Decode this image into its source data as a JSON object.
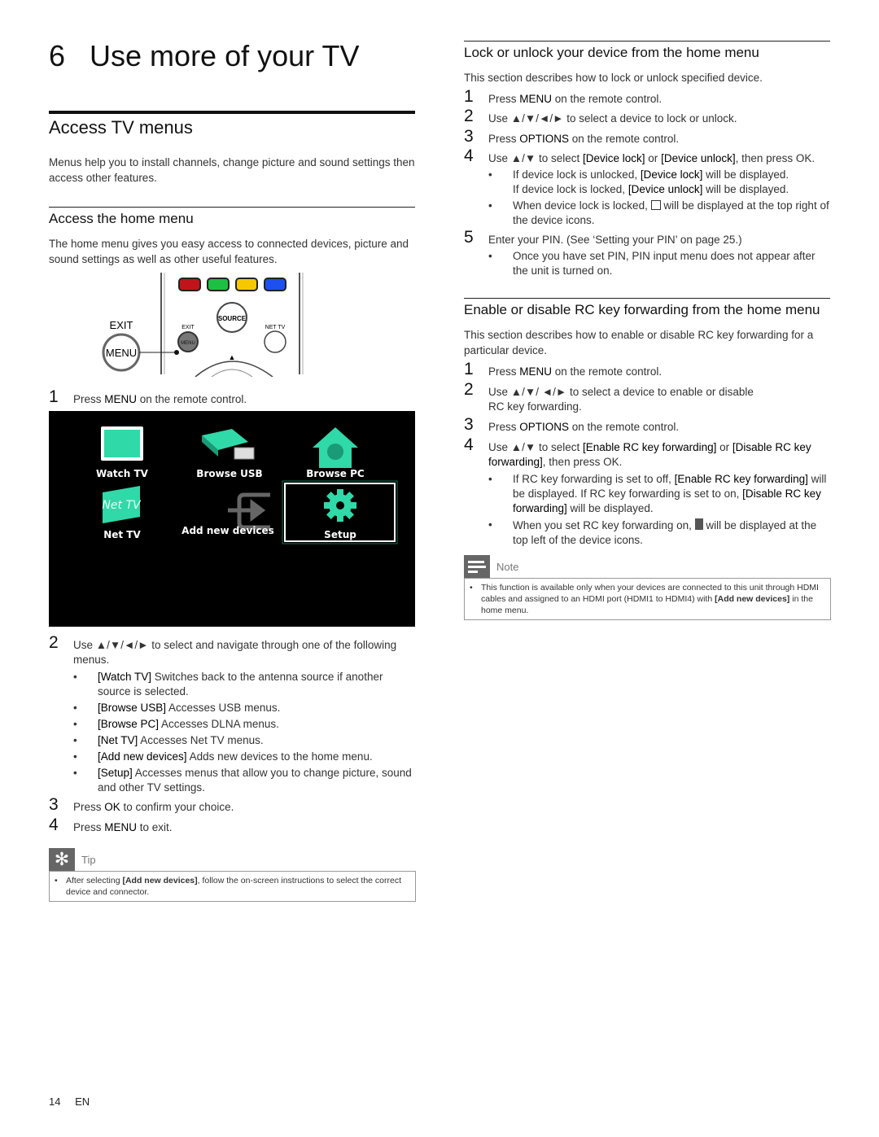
{
  "chapter": {
    "number": "6",
    "title": "Use more of your TV"
  },
  "left": {
    "section_title": "Access TV menus",
    "intro": "Menus help you to install channels, change picture and sound settings then access other features.",
    "subsection_title": "Access the home menu",
    "sub_intro": "The home menu gives you easy access to connected devices, picture and sound settings as well as other useful features.",
    "remote": {
      "exit_label": "EXIT",
      "menu_label": "MENU",
      "source_label": "SOURCE",
      "small_exit_label": "EXIT",
      "small_menu_label": "MENU",
      "nettv_label": "NET TV",
      "up_arrow": "▲",
      "button_colors": [
        "#c0141a",
        "#1dc042",
        "#f5c800",
        "#1e4ff0"
      ]
    },
    "step1": {
      "n": "1",
      "pre": "Press ",
      "key": "MENU",
      "post": " on the remote control."
    },
    "home_menu": {
      "items": [
        {
          "label": "Watch TV",
          "icon": "tv-icon"
        },
        {
          "label": "Browse USB",
          "icon": "usb-icon"
        },
        {
          "label": "Browse PC",
          "icon": "home-network-icon"
        },
        {
          "label": "Net TV",
          "icon": "nettv-icon",
          "icon_text": "Net TV"
        },
        {
          "label": "Add new devices",
          "icon": "add-device-icon"
        },
        {
          "label": "Setup",
          "icon": "gear-icon",
          "selected": true
        }
      ],
      "accent": "#2fd9a8"
    },
    "step2": {
      "n": "2",
      "text": "Use ▲/▼/◄/► to select and navigate through one of the following menus."
    },
    "step2_bullets": [
      {
        "key": "[Watch TV]",
        "text": " Switches back to the antenna source if another source is selected."
      },
      {
        "key": "[Browse USB]",
        "text": " Accesses USB menus."
      },
      {
        "key": "[Browse PC]",
        "text": " Accesses DLNA menus."
      },
      {
        "key": "[Net TV]",
        "text": " Accesses Net TV menus."
      },
      {
        "key": "[Add new devices]",
        "text": " Adds new devices to the home menu."
      },
      {
        "key": "[Setup]",
        "text": " Accesses menus that allow you to change picture, sound and other TV settings."
      }
    ],
    "step3": {
      "n": "3",
      "pre": "Press ",
      "key": "OK",
      "post": " to confirm your choice."
    },
    "step4": {
      "n": "4",
      "pre": "Press ",
      "key": "MENU",
      "post": " to exit."
    },
    "tip": {
      "label": "Tip",
      "pre": "After selecting ",
      "key": "[Add new devices]",
      "post": ", follow the on-screen instructions to select the correct device and connector."
    }
  },
  "right": {
    "lock": {
      "title": "Lock or unlock your device from the home menu",
      "intro": "This section describes how to lock or unlock specified device.",
      "s1": {
        "n": "1",
        "pre": "Press ",
        "key": "MENU",
        "post": " on the remote control."
      },
      "s2": {
        "n": "2",
        "text": "Use ▲/▼/◄/► to select a device to lock or unlock."
      },
      "s3": {
        "n": "3",
        "pre": "Press ",
        "key": "OPTIONS",
        "post": " on the remote control."
      },
      "s4": {
        "n": "4",
        "pre": "Use ▲/▼ to select ",
        "k1": "[Device lock]",
        "mid": " or ",
        "k2": "[Device unlock]",
        "post": ", then press OK."
      },
      "b1": {
        "l1pre": "If device lock is unlocked, ",
        "l1key": "[Device lock]",
        "l1post": " will be displayed.",
        "l2pre": "If device lock is locked, ",
        "l2key": "[Device unlock]",
        "l2post": " will be displayed."
      },
      "b2": {
        "pre": "When device lock is locked, ",
        "post": " will be displayed at the top right of the device icons."
      },
      "s5": {
        "n": "5",
        "text": "Enter your PIN. (See ‘Setting your PIN’ on page 25.)"
      },
      "b3": {
        "text": "Once you have set PIN, PIN input menu does not appear after the unit is turned on."
      }
    },
    "rc": {
      "title": "Enable or disable RC key forwarding from the home menu",
      "intro": "This section describes how to enable or disable RC key forwarding for a particular device.",
      "s1": {
        "n": "1",
        "pre": "Press ",
        "key": "MENU",
        "post": " on the remote control."
      },
      "s2": {
        "n": "2",
        "line1": "Use ▲/▼/ ◄/► to select a device to enable or disable",
        "line2": "RC key forwarding."
      },
      "s3": {
        "n": "3",
        "pre": "Press ",
        "key": "OPTIONS",
        "post": " on the remote control."
      },
      "s4": {
        "n": "4",
        "pre": "Use ▲/▼ to select ",
        "k1": "[Enable RC key forwarding]",
        "mid": " or ",
        "k2": "[Disable RC key forwarding]",
        "post": ", then press OK."
      },
      "b1": {
        "pre": "If RC key forwarding is set to off, ",
        "k1": "[Enable RC key forwarding]",
        "mid": " will be displayed. If RC key forwarding is set to on, ",
        "k2": "[Disable RC key forwarding]",
        "post": " will be displayed."
      },
      "b2": {
        "pre": "When you set RC key forwarding on, ",
        "post": " will be displayed at the top left of the device icons."
      }
    },
    "note": {
      "label": "Note",
      "pre": "This function is available only when your devices are connected to this unit through HDMI cables and assigned to an HDMI port (HDMI1 to HDMI4) with ",
      "key": "[Add new devices]",
      "post": " in the home menu."
    }
  },
  "footer": {
    "page": "14",
    "lang": "EN"
  }
}
